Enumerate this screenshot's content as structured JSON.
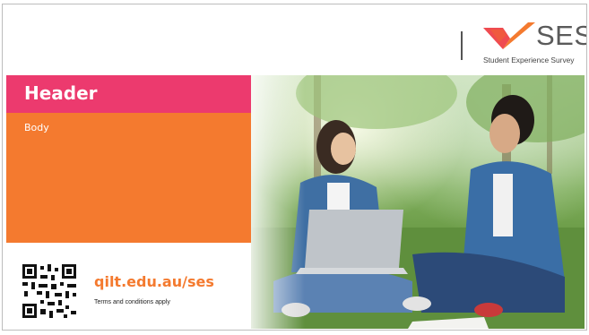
{
  "logo": {
    "name": "SES",
    "subtitle": "Student Experience Survey",
    "mark_icon": "checkmark-chevron-icon",
    "mark_colors": [
      "#ef4b50",
      "#f47a2f"
    ]
  },
  "header": {
    "label": "Header",
    "color": "#ec3a6e"
  },
  "body": {
    "label": "Body",
    "color": "#f47a2f"
  },
  "footer": {
    "url": "qilt.edu.au/ses",
    "terms": "Terms and conditions apply",
    "qr_icon": "qr-code-icon"
  },
  "photo": {
    "subject": "photo-icon"
  }
}
